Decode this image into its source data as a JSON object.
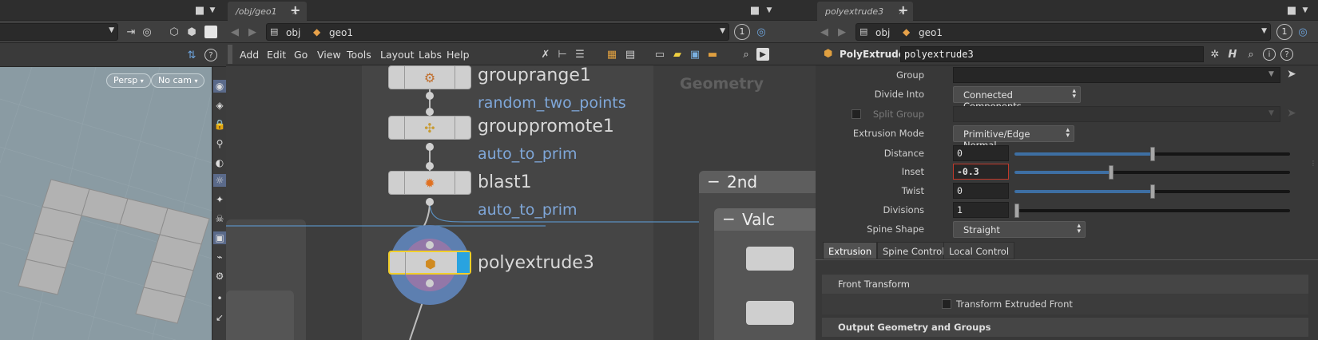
{
  "left_pane": {
    "viewport": {
      "camera_label": "Persp",
      "cam_label": "No cam"
    }
  },
  "middle_pane": {
    "tab": {
      "label": "/obj/geo1",
      "close": "×"
    },
    "new_tab": "+",
    "path": {
      "root": "obj",
      "node": "geo1"
    },
    "update_badge": "1",
    "menu": [
      "Add",
      "Edit",
      "Go",
      "View",
      "Tools",
      "Layout",
      "Labs",
      "Help"
    ],
    "network": {
      "context_label": "Geometry",
      "nodes": [
        {
          "name": "grouprange1",
          "comment": "random_two_points",
          "icon": "grouprange-icon"
        },
        {
          "name": "grouppromote1",
          "comment": "auto_to_prim",
          "icon": "grouppromote-icon"
        },
        {
          "name": "blast1",
          "comment": "auto_to_prim",
          "icon": "blast-icon"
        },
        {
          "name": "polyextrude3",
          "comment": "",
          "icon": "polyextrude-icon"
        }
      ],
      "boxes": [
        {
          "title": "2nd",
          "collapse": "−"
        },
        {
          "title": "Valc",
          "collapse": "−"
        }
      ]
    }
  },
  "right_pane": {
    "tab": {
      "label": "polyextrude3",
      "close": "×"
    },
    "new_tab": "+",
    "path": {
      "root": "obj",
      "node": "geo1"
    },
    "update_badge": "1",
    "node_type": "PolyExtrude",
    "node_name": "polyextrude3",
    "params": {
      "group": {
        "label": "Group",
        "value": ""
      },
      "divide_into": {
        "label": "Divide Into",
        "value": "Connected Components"
      },
      "split_group": {
        "label": "Split Group",
        "value": ""
      },
      "extrusion_mode": {
        "label": "Extrusion Mode",
        "value": "Primitive/Edge Normal"
      },
      "distance": {
        "label": "Distance",
        "value": "0",
        "slider_fraction": 0.5
      },
      "inset": {
        "label": "Inset",
        "value": "-0.3",
        "slider_fraction": 0.35
      },
      "twist": {
        "label": "Twist",
        "value": "0",
        "slider_fraction": 0.5
      },
      "divisions": {
        "label": "Divisions",
        "value": "1",
        "slider_fraction": 0.0
      },
      "spine_shape": {
        "label": "Spine Shape",
        "value": "Straight"
      }
    },
    "tabs": [
      "Extrusion",
      "Spine Control",
      "Local Control"
    ],
    "sections": {
      "front_transform": "Front Transform",
      "transform_front_label": "Transform Extruded Front",
      "output": "Output Geometry and Groups"
    }
  },
  "colors": {
    "comment_blue": "#7fa7d9",
    "selected_yellow": "#f2cf2a",
    "display_flag": "#29a3e0",
    "inset_error_border": "#c0392b"
  }
}
